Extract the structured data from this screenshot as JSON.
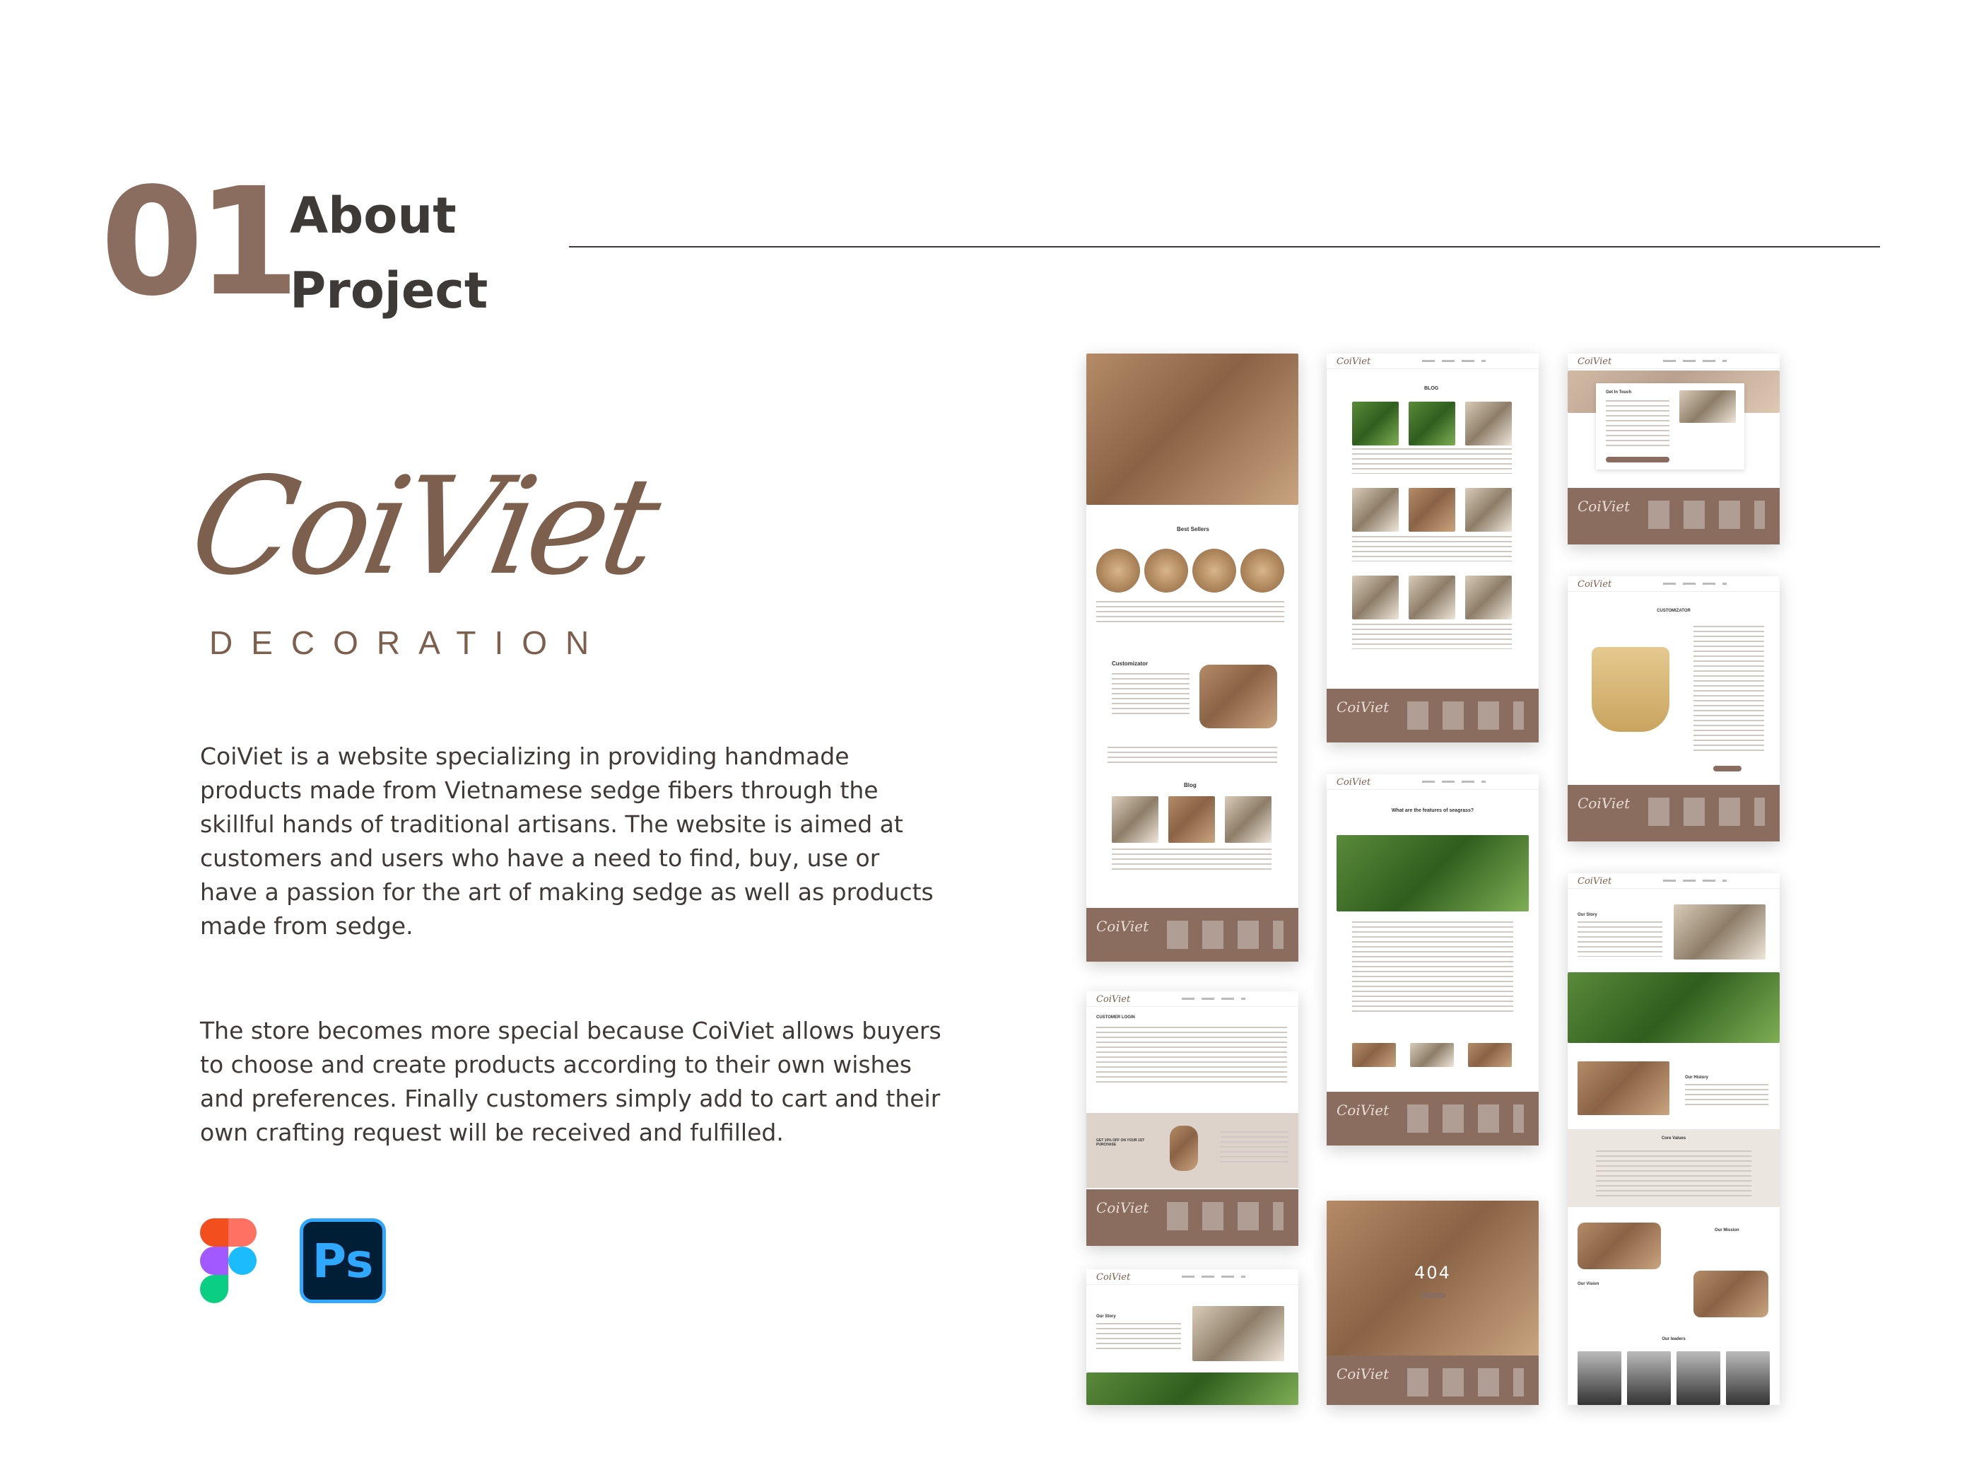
{
  "section": {
    "number": "01",
    "title_line1": "About",
    "title_line2": "Project"
  },
  "logo": {
    "script": "CoiViet",
    "subtitle": "DECORATION"
  },
  "description": {
    "paragraph1": "CoiViet is a website specializing in providing handmade products made from Vietnamese sedge fibers through the skillful hands of traditional artisans. The website is aimed at customers and users who have a need to find, buy, use or have a passion for the art of making sedge as well as products made from sedge.",
    "paragraph2": "The store becomes more special because CoiViet allows buyers to choose and create products according to their own wishes and preferences. Finally customers simply add to cart and their own crafting request will be received and fulfilled."
  },
  "tools": {
    "photoshop_label": "Ps",
    "icons": [
      "figma-icon",
      "photoshop-icon"
    ]
  },
  "mockups": {
    "home": {
      "section_best": "Best Sellers",
      "section_custom": "Customizator",
      "section_blog": "Blog"
    },
    "blog": {
      "heading": "BLOG"
    },
    "contact": {
      "heading": "Get In Touch"
    },
    "customizer": {
      "heading": "CUSTOMIZATOR"
    },
    "login": {
      "heading": "CUSTOMER LOGIN",
      "promo": "GET 10% OFF ON YOUR 1ST PURCHASE"
    },
    "article": {
      "heading": "What are the features of seagrass?"
    },
    "about": {
      "our_story": "Our Story",
      "our_history": "Our History",
      "core_values": "Core Values",
      "our_mission": "Our Mission",
      "our_vision": "Our Vision",
      "our_leaders": "Our leaders"
    },
    "error": {
      "code": "404"
    }
  },
  "colors": {
    "brand_brown": "#8a6d5e",
    "text_dark": "#3d3a38"
  }
}
